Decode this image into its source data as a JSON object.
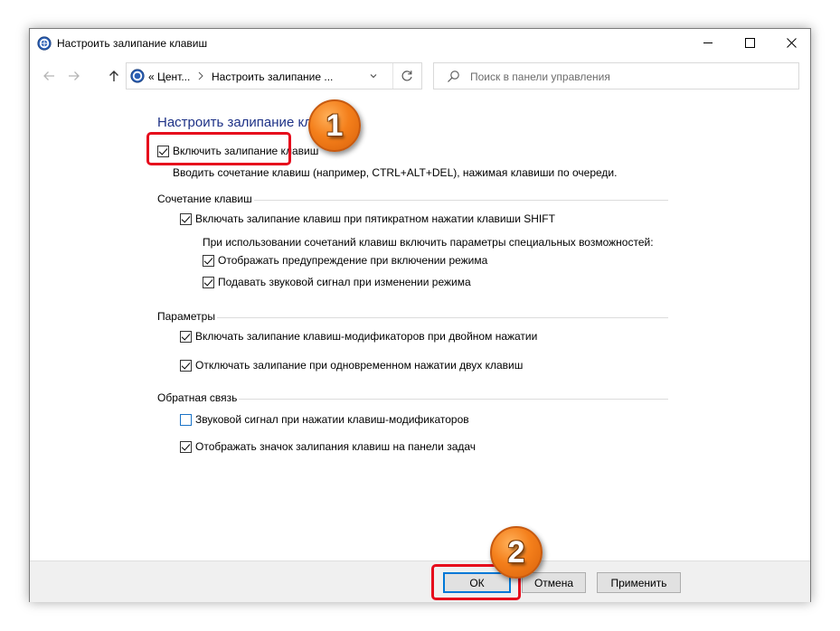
{
  "window": {
    "title": "Настроить залипание клавиш",
    "controls": {
      "minimize": "minimize",
      "maximize": "maximize",
      "close": "close"
    }
  },
  "navigation": {
    "breadcrumb": [
      "« Цент...",
      "Настроить залипание ..."
    ],
    "search_placeholder": "Поиск в панели управления"
  },
  "main": {
    "heading": "Настроить залипание кл",
    "enable_sticky_keys": {
      "label": "Включить залипание клавиш",
      "checked": true
    },
    "description": "Вводить сочетание клавиш (например, CTRL+ALT+DEL), нажимая клавиши по очереди.",
    "groups": {
      "shortcut": {
        "label": "Сочетание клавиш",
        "shift_five_times": {
          "label": "Включать залипание клавиш при пятикратном нажатии клавиши SHIFT",
          "checked": true
        },
        "sub_caption": "При использовании сочетаний клавиш включить параметры специальных возможностей:",
        "show_warning": {
          "label": "Отображать предупреждение при включении режима",
          "checked": true
        },
        "play_sound": {
          "label": "Подавать звуковой сигнал при изменении режима",
          "checked": true
        }
      },
      "options": {
        "label": "Параметры",
        "lock_modifier_twice": {
          "label": "Включать залипание клавиш-модификаторов при двойном нажатии",
          "checked": true
        },
        "turn_off_two_keys": {
          "label": "Отключать залипание при одновременном нажатии двух клавиш",
          "checked": true
        }
      },
      "feedback": {
        "label": "Обратная связь",
        "sound_on_modifier": {
          "label": "Звуковой сигнал при нажатии клавиш-модификаторов",
          "checked": false
        },
        "show_taskbar_icon": {
          "label": "Отображать значок залипания клавиш на панели задач",
          "checked": true
        }
      }
    }
  },
  "footer": {
    "ok_label": "ОК",
    "cancel_label": "Отмена",
    "apply_label": "Применить"
  },
  "annotations": {
    "step1": "1",
    "step2": "2",
    "highlight_color": "#e60b1c",
    "badge_color": "#f47f1b"
  },
  "colors": {
    "heading": "#1e3287",
    "default_button_border": "#0078d7"
  }
}
